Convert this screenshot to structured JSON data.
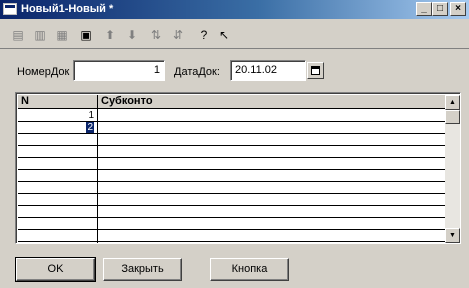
{
  "window": {
    "title": "Новый1-Новый *",
    "controls": [
      "minimize",
      "maximize",
      "close"
    ]
  },
  "toolbar": {
    "buttons": [
      {
        "name": "add-row",
        "icon": "add-row-icon",
        "glyph": "▤",
        "enabled": false
      },
      {
        "name": "copy-row",
        "icon": "copy-row-icon",
        "glyph": "▥",
        "enabled": false
      },
      {
        "name": "delete-row",
        "icon": "delete-row-icon",
        "glyph": "▦",
        "enabled": false
      },
      {
        "name": "edit-row",
        "icon": "edit-row-icon",
        "glyph": "▣",
        "enabled": true
      },
      {
        "name": "move-up",
        "icon": "arrow-up-icon",
        "glyph": "⬆",
        "enabled": false
      },
      {
        "name": "move-down",
        "icon": "arrow-down-icon",
        "glyph": "⬇",
        "enabled": false
      },
      {
        "name": "sort-asc",
        "icon": "sort-ascending-icon",
        "glyph": "⇅",
        "enabled": false
      },
      {
        "name": "sort-desc",
        "icon": "sort-descending-icon",
        "glyph": "⇵",
        "enabled": false
      },
      {
        "name": "help",
        "icon": "help-icon",
        "glyph": "?",
        "enabled": true
      },
      {
        "name": "context-help",
        "icon": "context-help-icon",
        "glyph": "↖",
        "enabled": true
      }
    ]
  },
  "form": {
    "doc_number_label": "НомерДок",
    "doc_number_value": "1",
    "doc_date_label": "ДатаДок:",
    "doc_date_value": "20.11.02"
  },
  "table": {
    "columns": [
      "N",
      "Субконто"
    ],
    "rows": [
      {
        "n": "1",
        "subkonto": "",
        "selected": false
      },
      {
        "n": "2",
        "subkonto": "",
        "selected": true
      }
    ],
    "empty_rows": 9
  },
  "buttons": {
    "ok": "OK",
    "close": "Закрыть",
    "button": "Кнопка"
  },
  "colors": {
    "titlebar_start": "#0a246a",
    "titlebar_end": "#a6caf0",
    "face": "#d4d0c8",
    "selection": "#0a246a"
  }
}
